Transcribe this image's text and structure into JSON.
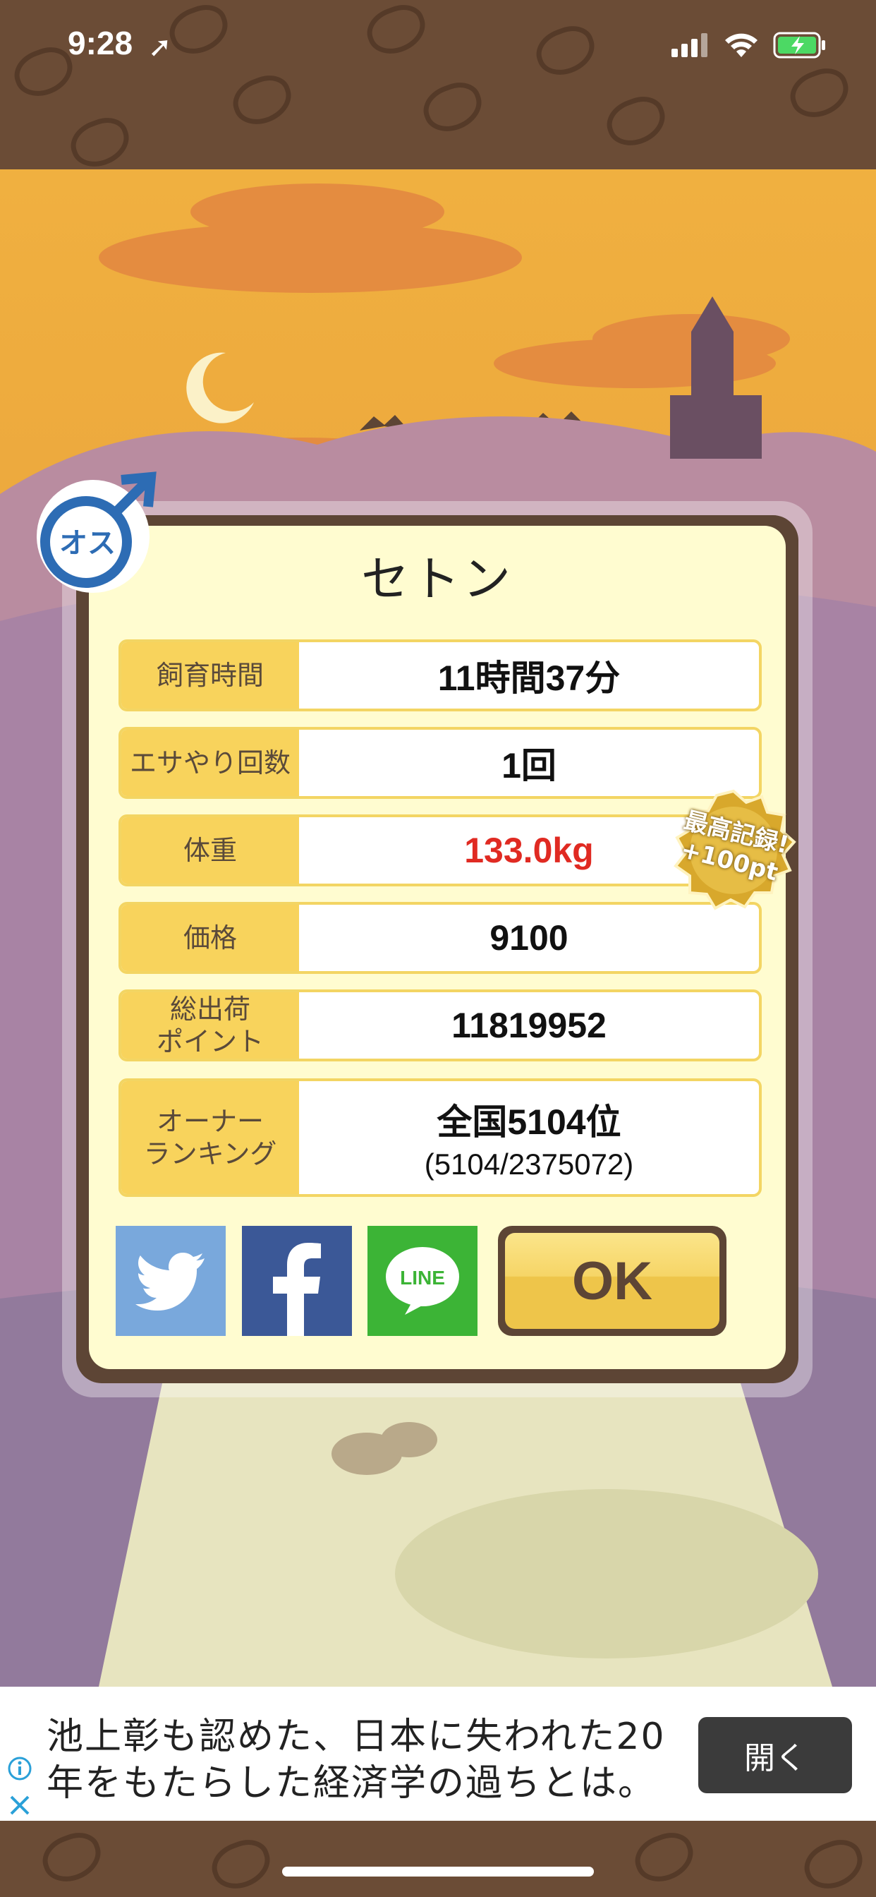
{
  "status_bar": {
    "time": "9:28"
  },
  "dialog": {
    "title": "セトン",
    "gender_badge": "オス",
    "rows": [
      {
        "label": "飼育時間",
        "value": "11時間37分"
      },
      {
        "label": "エサやり回数",
        "value": "1回"
      },
      {
        "label": "体重",
        "value": "133.0kg"
      },
      {
        "label": "価格",
        "value": "9100"
      },
      {
        "label": "総出荷\nポイント",
        "value": "11819952"
      },
      {
        "label": "オーナー\nランキング",
        "value": "全国5104位",
        "sub": "(5104/2375072)"
      }
    ],
    "record_badge": {
      "line1": "最高記録!",
      "line2": "+100pt"
    },
    "social": {
      "line_label": "LINE"
    },
    "ok_label": "OK"
  },
  "ad": {
    "text": "池上彰も認めた、日本に失われた20年をもたらした経済学の過ちとは。",
    "button_label": "開く"
  },
  "colors": {
    "scene_orange": "#f0b040",
    "scene_purple": "#a58aa2",
    "label_yellow": "#f8d35c",
    "dialog_brown": "#5d4535",
    "record_red": "#e02a22",
    "twitter": "#79a8dc",
    "facebook": "#3b5897",
    "line": "#3cb436"
  }
}
